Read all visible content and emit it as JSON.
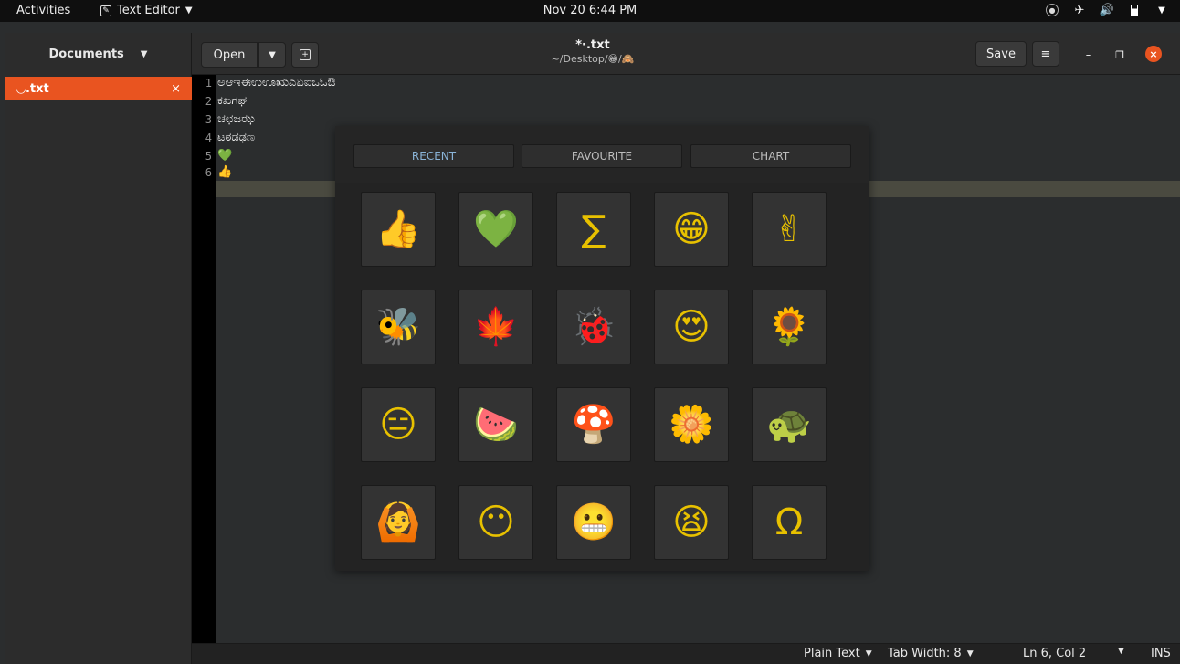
{
  "topbar": {
    "activities": "Activities",
    "app_name": "Text Editor",
    "clock": "Nov 20  6:44 PM"
  },
  "headerbar": {
    "documents_label": "Documents",
    "open_label": "Open",
    "save_label": "Save",
    "title": "*·.txt",
    "subtitle": "~/Desktop/😁/🙈"
  },
  "sidebar": {
    "doc_name": "◡.txt",
    "doc_close": "×"
  },
  "editor": {
    "line_numbers": [
      "1",
      "2",
      "3",
      "4",
      "5",
      "6"
    ],
    "lines": [
      "ಅಆಇಈಉಊಋಎಏಐಒಓಔ",
      "ಕಖಗಘ",
      "ಚಛಜಝ",
      "ಟಠಡಢಣ",
      "💚",
      "👍"
    ]
  },
  "emoji_panel": {
    "tabs": [
      "RECENT",
      "FAVOURITE",
      "CHART"
    ],
    "active_tab": "RECENT",
    "emojis": [
      "👍",
      "💚",
      "∑",
      "😁",
      "✌",
      "🐝",
      "🍁",
      "🐞",
      "😍",
      "🌻",
      "😑",
      "🍉",
      "🍄",
      "🌼",
      "🐢",
      "🙆",
      "😶",
      "😬",
      "😫",
      "Ω"
    ]
  },
  "statusbar": {
    "language": "Plain Text",
    "tab_width": "Tab Width: 8",
    "position": "Ln 6, Col 2",
    "mode": "INS"
  },
  "colors": {
    "accent": "#e95420",
    "tab_active": "#8ab4d8"
  }
}
